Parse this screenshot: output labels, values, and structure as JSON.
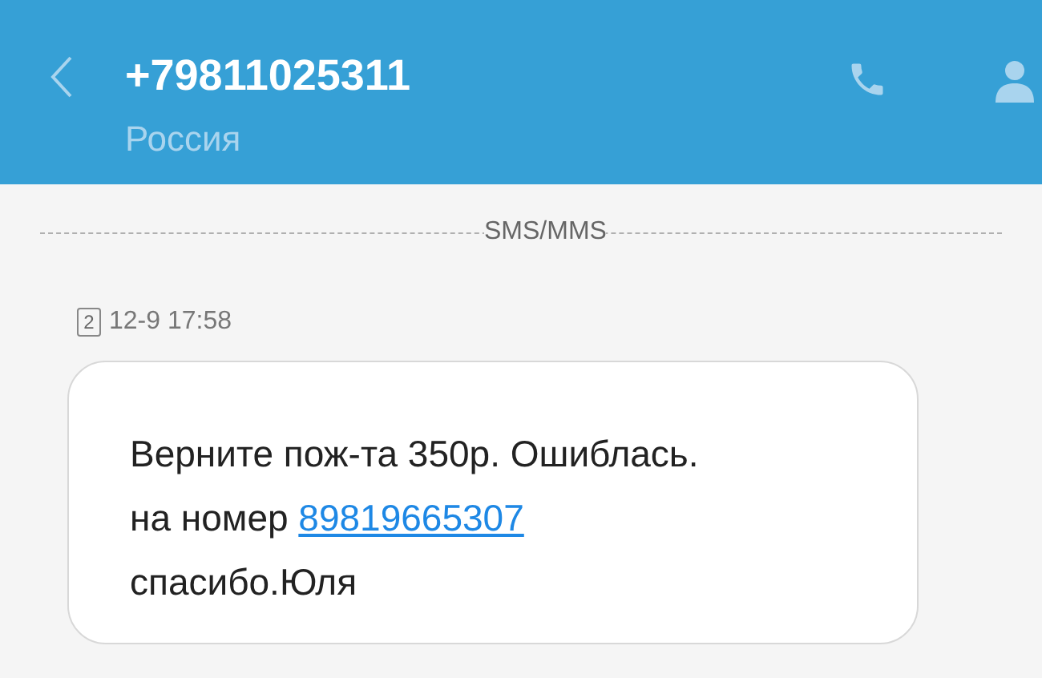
{
  "header": {
    "title": "+79811025311",
    "subtitle": "Россия"
  },
  "divider": {
    "label": "SMS/MMS"
  },
  "message": {
    "sim": "2",
    "time": "12-9 17:58",
    "lines": [
      {
        "text": "Верните пож-та 350р. Ошиблась."
      },
      {
        "text": "на номер ",
        "link": "89819665307"
      },
      {
        "text": "спасибо.Юля"
      }
    ]
  }
}
